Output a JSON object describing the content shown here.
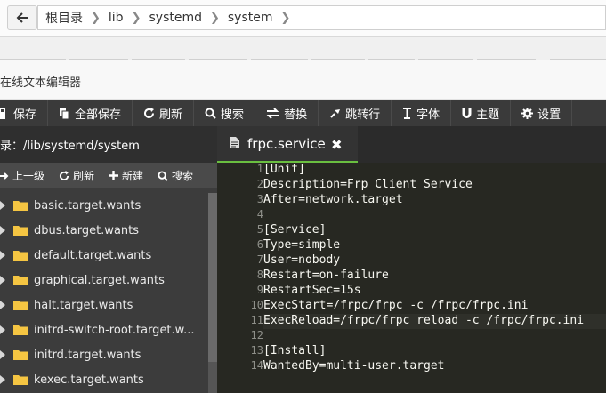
{
  "breadcrumb": {
    "items": [
      "根目录",
      "lib",
      "systemd",
      "system"
    ]
  },
  "editor_window": {
    "title": "在线文本编辑器"
  },
  "toolbar": {
    "save": "保存",
    "save_all": "全部保存",
    "refresh": "刷新",
    "search": "搜索",
    "replace": "替换",
    "goto_line": "跳转行",
    "font": "字体",
    "theme": "主题",
    "settings": "设置"
  },
  "sidebar": {
    "path_label": "目录：/lib/systemd/system",
    "tools": {
      "up": "上一级",
      "refresh": "刷新",
      "new": "新建",
      "search": "搜索"
    },
    "items": [
      "basic.target.wants",
      "dbus.target.wants",
      "default.target.wants",
      "graphical.target.wants",
      "halt.target.wants",
      "initrd-switch-root.target.w...",
      "initrd.target.wants",
      "kexec.target.wants"
    ]
  },
  "tab": {
    "filename": "frpc.service"
  },
  "code": {
    "line_numbers": [
      "1",
      "2",
      "3",
      "4",
      "5",
      "6",
      "7",
      "8",
      "9",
      "10",
      "11",
      "12",
      "13",
      "14"
    ],
    "lines": [
      "[Unit]",
      "Description=Frp Client Service",
      "After=network.target",
      "",
      "[Service]",
      "Type=simple",
      "User=nobody",
      "Restart=on-failure",
      "RestartSec=15s",
      "ExecStart=/frpc/frpc -c /frpc/frpc.ini",
      "ExecReload=/frpc/frpc reload -c /frpc/frpc.ini",
      "",
      "[Install]",
      "WantedBy=multi-user.target"
    ]
  },
  "colors": {
    "toolbar_bg": "#3a3a3a",
    "editor_bg": "#272822",
    "tab_accent": "#6abf40",
    "folder": "#f5c542"
  }
}
